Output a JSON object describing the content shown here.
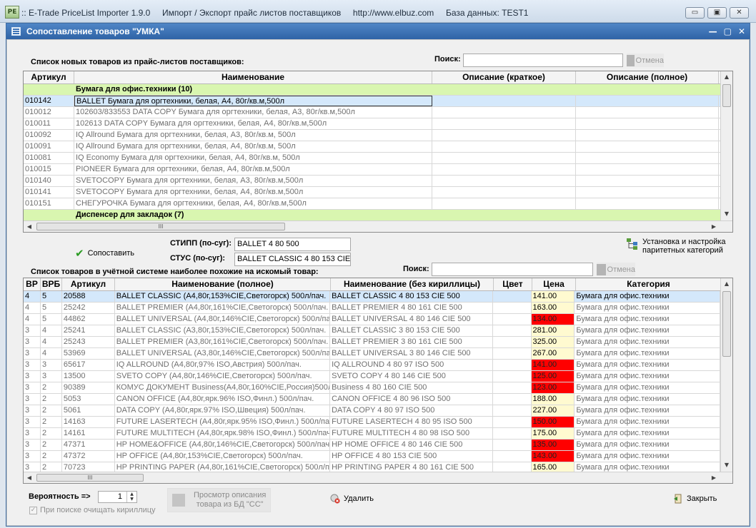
{
  "app": {
    "icon_text": "PE",
    "title": ":: E-Trade PriceList Importer 1.9.0     Импорт / Экспорт прайс листов поставщиков     http://www.elbuz.com     База данных: TEST1",
    "controls": [
      "▭",
      "▣",
      "✕"
    ]
  },
  "window": {
    "title": "Сопоставление товаров \"УМКА\"",
    "controls": [
      "—",
      "▢",
      "✕"
    ]
  },
  "top_section": {
    "caption": "Список новых товаров из прайс-листов поставщиков:",
    "search_label": "Поиск:",
    "search_value": "",
    "cancel_label": "Отмена",
    "columns": [
      "Артикул",
      "Наименование",
      "Описание (краткое)",
      "Описание (полное)"
    ],
    "rows": [
      {
        "kind": "group",
        "cells": [
          "",
          "Бумага для офис.техники (10)",
          "",
          ""
        ]
      },
      {
        "kind": "sel",
        "cells": [
          "010142",
          "BALLET Бумага для оргтехники, белая, А4, 80г/кв.м,500л",
          "",
          ""
        ]
      },
      {
        "kind": "row",
        "cells": [
          "010012",
          "102603/833553 DATA COPY Бумага для оргтехники, белая, А3, 80г/кв.м,500л",
          "",
          ""
        ]
      },
      {
        "kind": "row",
        "cells": [
          "010011",
          "102613 DATA COPY Бумага для оргтехники, белая, А4, 80г/кв.м,500л",
          "",
          ""
        ]
      },
      {
        "kind": "row",
        "cells": [
          "010092",
          "IQ Allround Бумага для оргтехники, белая, А3, 80г/кв.м, 500л",
          "",
          ""
        ]
      },
      {
        "kind": "row",
        "cells": [
          "010091",
          "IQ Allround Бумага для оргтехники, белая, А4, 80г/кв.м, 500л",
          "",
          ""
        ]
      },
      {
        "kind": "row",
        "cells": [
          "010081",
          "IQ Economy Бумага для оргтехники, белая, А4, 80г/кв.м, 500л",
          "",
          ""
        ]
      },
      {
        "kind": "row",
        "cells": [
          "010015",
          "PIONEER Бумага для оргтехники, белая, А4, 80г/кв.м,500л",
          "",
          ""
        ]
      },
      {
        "kind": "row",
        "cells": [
          "010140",
          "SVETOCOPY Бумага для оргтехники, белая, А3, 80г/кв.м,500л",
          "",
          ""
        ]
      },
      {
        "kind": "row",
        "cells": [
          "010141",
          "SVETOCOPY Бумага для оргтехники, белая, А4, 80г/кв.м,500л",
          "",
          ""
        ]
      },
      {
        "kind": "row",
        "cells": [
          "010151",
          "СНЕГУРОЧКА Бумага для оргтехники, белая, А4, 80г/кв.м,500л",
          "",
          ""
        ]
      },
      {
        "kind": "group",
        "cells": [
          "",
          "Диспенсер для закладок (7)",
          "",
          ""
        ]
      }
    ],
    "hscroll_grip": "III"
  },
  "match": {
    "button_label": "Сопоставить",
    "stipp_label": "СТИПП (по-суг):",
    "stipp_value": "BALLET 4 80 500",
    "stus_label": "СТУС (по-суг):",
    "stus_value": "BALLET CLASSIC 4 80 153 CIE 500",
    "settings_label_line1": "Установка и настройка",
    "settings_label_line2": "паритетных категорий"
  },
  "bottom_section": {
    "caption": "Список товаров в учётной системе наиболее похожие на искомый товар:",
    "search_label": "Поиск:",
    "search_value": "",
    "cancel_label": "Отмена",
    "columns": [
      "ВР",
      "ВРБ",
      "Артикул",
      "Наименование (полное)",
      "Наименование (без кириллицы)",
      "Цвет",
      "Цена",
      "Категория"
    ],
    "rows": [
      {
        "sel": true,
        "red": false,
        "cells": [
          "4",
          "5",
          "20588",
          "BALLET CLASSIC (A4,80г,153%CIE,Светогорск) 500л/пач.",
          "BALLET CLASSIC 4 80 153 CIE 500",
          "",
          "141.00",
          "Бумага для офис.техники"
        ]
      },
      {
        "sel": false,
        "red": false,
        "cells": [
          "4",
          "5",
          "25242",
          "BALLET PREMIER (A4,80г,161%CIE,Светогорск) 500л/пач.",
          "BALLET PREMIER 4 80 161 CIE 500",
          "",
          "163.00",
          "Бумага для офис.техники"
        ]
      },
      {
        "sel": false,
        "red": true,
        "cells": [
          "4",
          "5",
          "44862",
          "BALLET UNIVERSAL (A4,80г,146%CIE,Светогорск) 500л/пач",
          "BALLET UNIVERSAL 4 80 146 CIE 500",
          "",
          "134.00",
          "Бумага для офис.техники"
        ]
      },
      {
        "sel": false,
        "red": false,
        "cells": [
          "3",
          "4",
          "25241",
          "BALLET CLASSIC (A3,80г,153%CIE,Светогорск) 500л/пач.",
          "BALLET CLASSIC 3 80 153 CIE 500",
          "",
          "281.00",
          "Бумага для офис.техники"
        ]
      },
      {
        "sel": false,
        "red": false,
        "cells": [
          "3",
          "4",
          "25243",
          "BALLET PREMIER (A3,80г,161%CIE,Светогорск) 500л/пач.",
          "BALLET PREMIER 3 80 161 CIE 500",
          "",
          "325.00",
          "Бумага для офис.техники"
        ]
      },
      {
        "sel": false,
        "red": false,
        "cells": [
          "3",
          "4",
          "53969",
          "BALLET UNIVERSAL (A3,80г,146%CIE,Светогорск) 500л/пач.",
          "BALLET UNIVERSAL 3 80 146 CIE 500",
          "",
          "267.00",
          "Бумага для офис.техники"
        ]
      },
      {
        "sel": false,
        "red": true,
        "cells": [
          "3",
          "3",
          "65617",
          "IQ ALLROUND (A4,80г,97% ISO,Австрия) 500л/пач.",
          "IQ ALLROUND 4 80 97 ISO 500",
          "",
          "141.00",
          "Бумага для офис.техники"
        ]
      },
      {
        "sel": false,
        "red": true,
        "cells": [
          "3",
          "3",
          "13500",
          "SVETO COPY (A4,80г,146%CIE,Светогорск) 500л/пач.",
          "SVETO COPY 4 80 146 CIE 500",
          "",
          "125.00",
          "Бумага для офис.техники"
        ]
      },
      {
        "sel": false,
        "red": true,
        "cells": [
          "3",
          "2",
          "90389",
          "КОМУС ДОКУМЕНТ Business(A4,80г,160%CIE,Россия)500л",
          "Business 4 80 160 CIE 500",
          "",
          "123.00",
          "Бумага для офис.техники"
        ]
      },
      {
        "sel": false,
        "red": false,
        "cells": [
          "3",
          "2",
          "5053",
          "CANON OFFICE (A4,80г,ярк.96% ISO,Финл.) 500л/пач.",
          "CANON OFFICE 4 80 96 ISO 500",
          "",
          "188.00",
          "Бумага для офис.техники"
        ]
      },
      {
        "sel": false,
        "red": false,
        "cells": [
          "3",
          "2",
          "5061",
          "DATA COPY (A4,80г,ярк.97% ISO,Швеция) 500л/пач.",
          "DATA COPY 4 80 97 ISO 500",
          "",
          "227.00",
          "Бумага для офис.техники"
        ]
      },
      {
        "sel": false,
        "red": true,
        "cells": [
          "3",
          "2",
          "14163",
          "FUTURE LASERTECH (A4,80г,ярк.95% ISO,Финл.) 500л/пач.",
          "FUTURE LASERTECH 4 80 95 ISO 500",
          "",
          "150.00",
          "Бумага для офис.техники"
        ]
      },
      {
        "sel": false,
        "red": false,
        "cells": [
          "3",
          "2",
          "14161",
          "FUTURE MULTITECH (A4,80г,ярк.98% ISO,Финл.) 500л/пач.",
          "FUTURE MULTITECH 4 80 98 ISO 500",
          "",
          "175.00",
          "Бумага для офис.техники"
        ]
      },
      {
        "sel": false,
        "red": true,
        "cells": [
          "3",
          "2",
          "47371",
          "HP HOME&OFFICE (A4,80г,146%CIE,Светогорск) 500л/пач.",
          "HP HOME OFFICE 4 80 146 CIE 500",
          "",
          "135.00",
          "Бумага для офис.техники"
        ]
      },
      {
        "sel": false,
        "red": true,
        "cells": [
          "3",
          "2",
          "47372",
          "HP OFFICE (A4,80г,153%CIE,Светогорск) 500л/пач.",
          "HP OFFICE 4 80 153 CIE 500",
          "",
          "143.00",
          "Бумага для офис.техники"
        ]
      },
      {
        "sel": false,
        "red": false,
        "cells": [
          "3",
          "2",
          "70723",
          "HP PRINTING PAPER (A4,80г,161%CIE,Светогорск) 500л/па",
          "HP PRINTING PAPER 4 80 161 CIE 500",
          "",
          "165.00",
          "Бумага для офис.техники"
        ]
      }
    ],
    "hscroll_grip": "III"
  },
  "footer": {
    "prob_label": "Вероятность =>",
    "prob_value": "1",
    "clear_cyr_label": "При поиске очищать кириллицу",
    "view_desc_line1": "Просмотр описания",
    "view_desc_line2": "товара из БД \"СС\"",
    "delete_label": "Удалить",
    "close_label": "Закрыть"
  },
  "colors": {
    "group_row": "#d9f6b0",
    "selected_row": "#d4e8fb",
    "price_normal": "#fffad0",
    "price_alert": "#ff0000",
    "title_bar": "#2f63a6"
  }
}
